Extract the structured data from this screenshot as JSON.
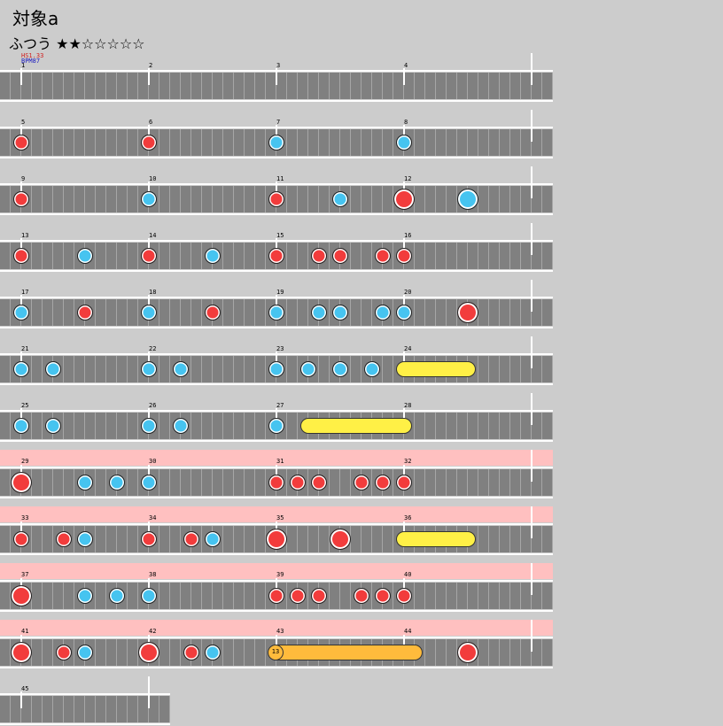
{
  "title": "対象a",
  "difficulty": {
    "label": "ふつう",
    "stars": "★★☆☆☆☆☆"
  },
  "info": {
    "hs": "HS1.33",
    "bpm": "BPM87"
  },
  "colors": {
    "background": "#cccccc",
    "lane": "#808080",
    "gogo": "#ffc0c0",
    "don": "#f23c3c",
    "ka": "#46c4f0",
    "drumroll": "#fff046",
    "balloon": "#ffbb3c"
  },
  "beats_per_measure": 12,
  "rows": [
    {
      "measures": [
        1,
        2,
        3,
        4
      ],
      "gogo": false,
      "notes": [],
      "rolls": []
    },
    {
      "measures": [
        5,
        6,
        7,
        8
      ],
      "gogo": false,
      "notes": [
        [
          0,
          "red",
          "small"
        ],
        [
          12,
          "red",
          "small"
        ],
        [
          24,
          "blue",
          "small"
        ],
        [
          36,
          "blue",
          "small"
        ]
      ],
      "rolls": []
    },
    {
      "measures": [
        9,
        10,
        11,
        12
      ],
      "gogo": false,
      "notes": [
        [
          0,
          "red",
          "small"
        ],
        [
          12,
          "blue",
          "small"
        ],
        [
          24,
          "red",
          "small"
        ],
        [
          30,
          "blue",
          "small"
        ],
        [
          36,
          "red",
          "big"
        ],
        [
          42,
          "blue",
          "big"
        ]
      ],
      "rolls": []
    },
    {
      "measures": [
        13,
        14,
        15,
        16
      ],
      "gogo": false,
      "notes": [
        [
          0,
          "red",
          "small"
        ],
        [
          6,
          "blue",
          "small"
        ],
        [
          12,
          "red",
          "small"
        ],
        [
          18,
          "blue",
          "small"
        ],
        [
          24,
          "red",
          "small"
        ],
        [
          28,
          "red",
          "small"
        ],
        [
          30,
          "red",
          "small"
        ],
        [
          34,
          "red",
          "small"
        ],
        [
          36,
          "red",
          "small"
        ]
      ],
      "rolls": []
    },
    {
      "measures": [
        17,
        18,
        19,
        20
      ],
      "gogo": false,
      "notes": [
        [
          0,
          "blue",
          "small"
        ],
        [
          6,
          "red",
          "small"
        ],
        [
          12,
          "blue",
          "small"
        ],
        [
          18,
          "red",
          "small"
        ],
        [
          24,
          "blue",
          "small"
        ],
        [
          28,
          "blue",
          "small"
        ],
        [
          30,
          "blue",
          "small"
        ],
        [
          34,
          "blue",
          "small"
        ],
        [
          36,
          "blue",
          "small"
        ],
        [
          42,
          "red",
          "big"
        ]
      ],
      "rolls": []
    },
    {
      "measures": [
        21,
        22,
        23,
        24
      ],
      "gogo": false,
      "notes": [
        [
          0,
          "blue",
          "small"
        ],
        [
          3,
          "blue",
          "small"
        ],
        [
          12,
          "blue",
          "small"
        ],
        [
          15,
          "blue",
          "small"
        ],
        [
          24,
          "blue",
          "small"
        ],
        [
          27,
          "blue",
          "small"
        ],
        [
          30,
          "blue",
          "small"
        ],
        [
          33,
          "blue",
          "small"
        ]
      ],
      "rolls": [
        {
          "start": 36,
          "end": 42,
          "type": "yellow"
        }
      ]
    },
    {
      "measures": [
        25,
        26,
        27,
        28
      ],
      "gogo": false,
      "notes": [
        [
          0,
          "blue",
          "small"
        ],
        [
          3,
          "blue",
          "small"
        ],
        [
          12,
          "blue",
          "small"
        ],
        [
          15,
          "blue",
          "small"
        ],
        [
          24,
          "blue",
          "small"
        ]
      ],
      "rolls": [
        {
          "start": 27,
          "end": 36,
          "type": "yellow"
        }
      ]
    },
    {
      "measures": [
        29,
        30,
        31,
        32
      ],
      "gogo": true,
      "notes": [
        [
          0,
          "red",
          "big"
        ],
        [
          6,
          "blue",
          "small"
        ],
        [
          9,
          "blue",
          "small"
        ],
        [
          12,
          "blue",
          "small"
        ],
        [
          24,
          "red",
          "small"
        ],
        [
          26,
          "red",
          "small"
        ],
        [
          28,
          "red",
          "small"
        ],
        [
          32,
          "red",
          "small"
        ],
        [
          34,
          "red",
          "small"
        ],
        [
          36,
          "red",
          "small"
        ]
      ],
      "rolls": []
    },
    {
      "measures": [
        33,
        34,
        35,
        36
      ],
      "gogo": true,
      "notes": [
        [
          0,
          "red",
          "small"
        ],
        [
          4,
          "red",
          "small"
        ],
        [
          6,
          "blue",
          "small"
        ],
        [
          12,
          "red",
          "small"
        ],
        [
          16,
          "red",
          "small"
        ],
        [
          18,
          "blue",
          "small"
        ],
        [
          24,
          "red",
          "big"
        ],
        [
          30,
          "red",
          "big"
        ]
      ],
      "rolls": [
        {
          "start": 36,
          "end": 42,
          "type": "yellow"
        }
      ]
    },
    {
      "measures": [
        37,
        38,
        39,
        40
      ],
      "gogo": true,
      "notes": [
        [
          0,
          "red",
          "big"
        ],
        [
          6,
          "blue",
          "small"
        ],
        [
          9,
          "blue",
          "small"
        ],
        [
          12,
          "blue",
          "small"
        ],
        [
          24,
          "red",
          "small"
        ],
        [
          26,
          "red",
          "small"
        ],
        [
          28,
          "red",
          "small"
        ],
        [
          32,
          "red",
          "small"
        ],
        [
          34,
          "red",
          "small"
        ],
        [
          36,
          "red",
          "small"
        ]
      ],
      "rolls": []
    },
    {
      "measures": [
        41,
        42,
        43,
        44
      ],
      "gogo": true,
      "notes": [
        [
          0,
          "red",
          "big"
        ],
        [
          4,
          "red",
          "small"
        ],
        [
          6,
          "blue",
          "small"
        ],
        [
          12,
          "red",
          "big"
        ],
        [
          16,
          "red",
          "small"
        ],
        [
          18,
          "blue",
          "small"
        ],
        [
          42,
          "red",
          "big"
        ]
      ],
      "rolls": [
        {
          "start": 24,
          "end": 37,
          "type": "orange",
          "label": "13"
        }
      ]
    },
    {
      "measures": [
        45
      ],
      "gogo": false,
      "notes": [],
      "rolls": []
    }
  ]
}
